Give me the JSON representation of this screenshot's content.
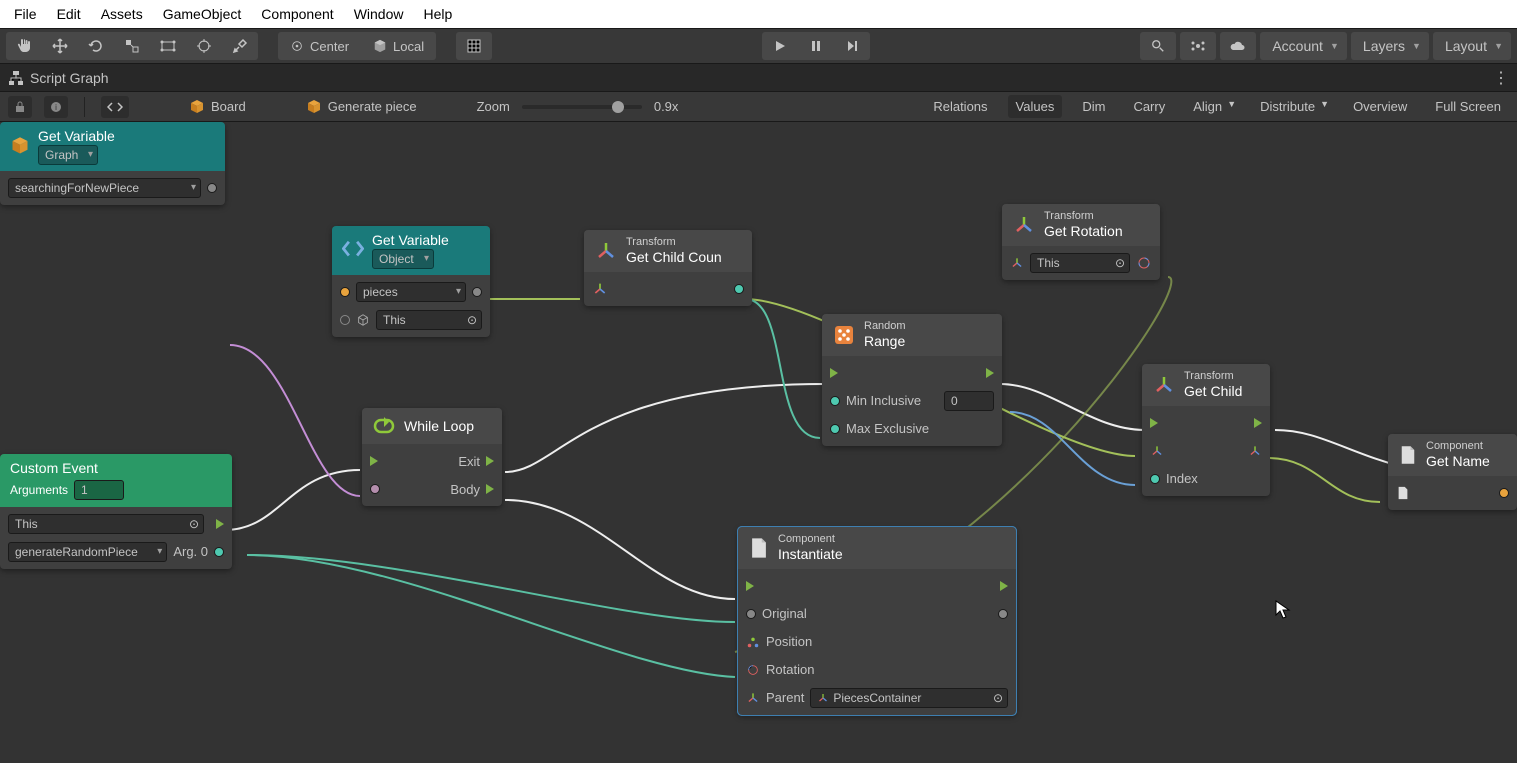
{
  "menubar": [
    "File",
    "Edit",
    "Assets",
    "GameObject",
    "Component",
    "Window",
    "Help"
  ],
  "toolbar": {
    "center": "Center",
    "local": "Local",
    "account": "Account",
    "layers": "Layers",
    "layout": "Layout"
  },
  "tab": {
    "title": "Script Graph"
  },
  "graphbar": {
    "crumb1": "Board",
    "crumb2": "Generate piece",
    "zoom_label": "Zoom",
    "zoom_value": "0.9x",
    "opts": [
      "Relations",
      "Values",
      "Dim",
      "Carry",
      "Align",
      "Distribute",
      "Overview",
      "Full Screen"
    ]
  },
  "nodes": {
    "getvar1": {
      "title": "Get Variable",
      "scope": "Graph",
      "value": "searchingForNewPiece"
    },
    "getvar2": {
      "title": "Get Variable",
      "scope": "Object",
      "value": "pieces",
      "target": "This"
    },
    "childcount": {
      "cat": "Transform",
      "name": "Get Child Coun"
    },
    "getrot": {
      "cat": "Transform",
      "name": "Get Rotation",
      "target": "This"
    },
    "random": {
      "cat": "Random",
      "name": "Range",
      "min_label": "Min Inclusive",
      "min_val": "0",
      "max_label": "Max Exclusive"
    },
    "getchild": {
      "cat": "Transform",
      "name": "Get Child",
      "index_label": "Index"
    },
    "getname": {
      "cat": "Component",
      "name": "Get Name"
    },
    "while": {
      "name": "While Loop",
      "exit": "Exit",
      "body": "Body"
    },
    "customevt": {
      "title": "Custom Event",
      "args_label": "Arguments",
      "args_val": "1",
      "target": "This",
      "evt": "generateRandomPiece",
      "arg0": "Arg. 0"
    },
    "instantiate": {
      "cat": "Component",
      "name": "Instantiate",
      "original": "Original",
      "position": "Position",
      "rotation": "Rotation",
      "parent_label": "Parent",
      "parent_val": "PiecesContainer"
    }
  }
}
